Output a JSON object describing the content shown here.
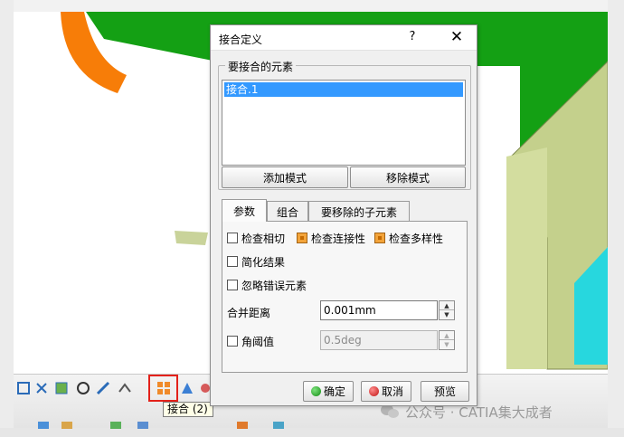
{
  "dialog": {
    "title": "接合定义",
    "help_label": "?",
    "close_label": "✕",
    "elements_group_label": "要接合的元素",
    "elements_list": [
      "接合.1"
    ],
    "add_mode_label": "添加模式",
    "remove_mode_label": "移除模式",
    "tabs": [
      "参数",
      "组合",
      "要移除的子元素"
    ],
    "active_tab": "参数",
    "checkboxes": {
      "check_tangency": {
        "label": "检查相切",
        "checked": false
      },
      "check_connectivity": {
        "label": "检查连接性",
        "checked": true
      },
      "check_manifold": {
        "label": "检查多样性",
        "checked": true
      },
      "simplify_result": {
        "label": "简化结果",
        "checked": false
      },
      "ignore_erroneous": {
        "label": "忽略错误元素",
        "checked": false
      },
      "angular_threshold": {
        "label": "角阈值",
        "checked": false
      }
    },
    "merge_distance_label": "合并距离",
    "merge_distance_value": "0.001mm",
    "angular_threshold_value": "0.5deg",
    "ok_label": "确定",
    "cancel_label": "取消",
    "preview_label": "预览"
  },
  "tooltip": "接合 (2)",
  "watermark": "公众号 · CATIA集大成者",
  "colors": {
    "selection": "#3399ff",
    "highlight": "#e3211a",
    "surface_green": "#14a014",
    "surface_olive": "#c4d08c",
    "orange_ring": "#f77d08",
    "cyan_face": "#27d7de"
  }
}
